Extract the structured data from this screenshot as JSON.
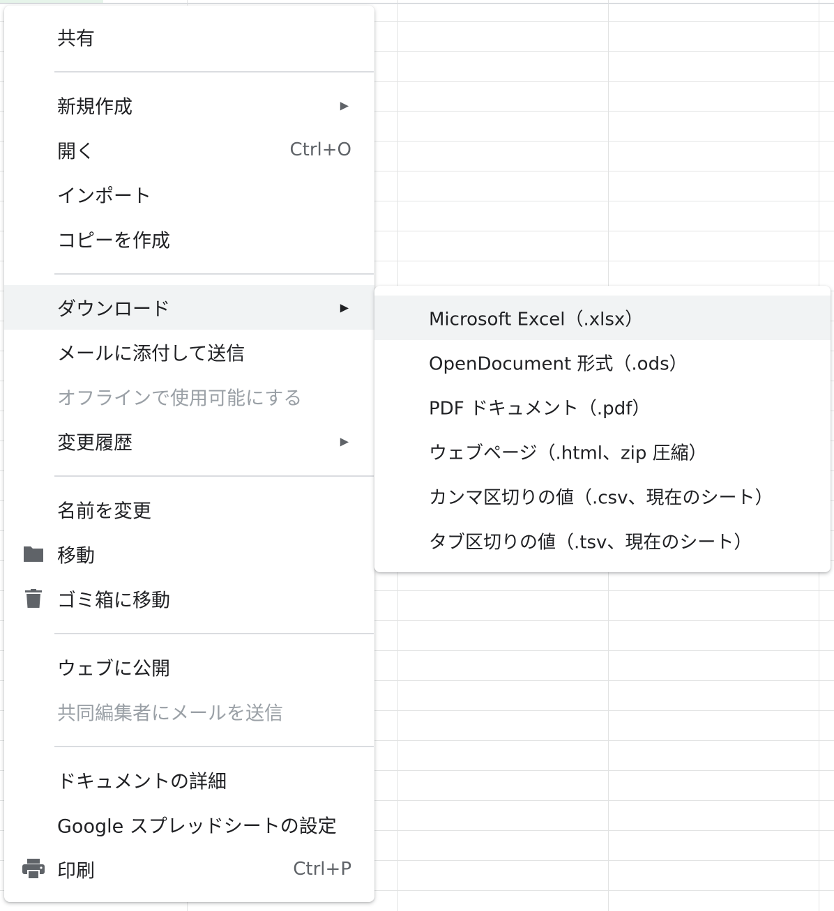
{
  "menu": {
    "share": "共有",
    "new": "新規作成",
    "open": "開く",
    "open_shortcut": "Ctrl+O",
    "import": "インポート",
    "make_copy": "コピーを作成",
    "download": "ダウンロード",
    "email_attachment": "メールに添付して送信",
    "make_offline": "オフラインで使用可能にする",
    "version_history": "変更履歴",
    "rename": "名前を変更",
    "move": "移動",
    "move_to_trash": "ゴミ箱に移動",
    "publish_to_web": "ウェブに公開",
    "email_collaborators": "共同編集者にメールを送信",
    "document_details": "ドキュメントの詳細",
    "settings": "Google スプレッドシートの設定",
    "print": "印刷",
    "print_shortcut": "Ctrl+P",
    "submenu_arrow": "▶"
  },
  "download_submenu": {
    "items": [
      "Microsoft Excel（.xlsx）",
      "OpenDocument 形式（.ods）",
      "PDF ドキュメント（.pdf）",
      "ウェブページ（.html、zip 圧縮）",
      "カンマ区切りの値（.csv、現在のシート）",
      "タブ区切りの値（.tsv、現在のシート）"
    ]
  },
  "icons": {
    "move": "folder-icon",
    "trash": "trash-icon",
    "print": "printer-icon"
  },
  "colors": {
    "highlight": "#f1f3f4",
    "disabled_text": "#9aa0a6",
    "icon": "#5f6368"
  }
}
